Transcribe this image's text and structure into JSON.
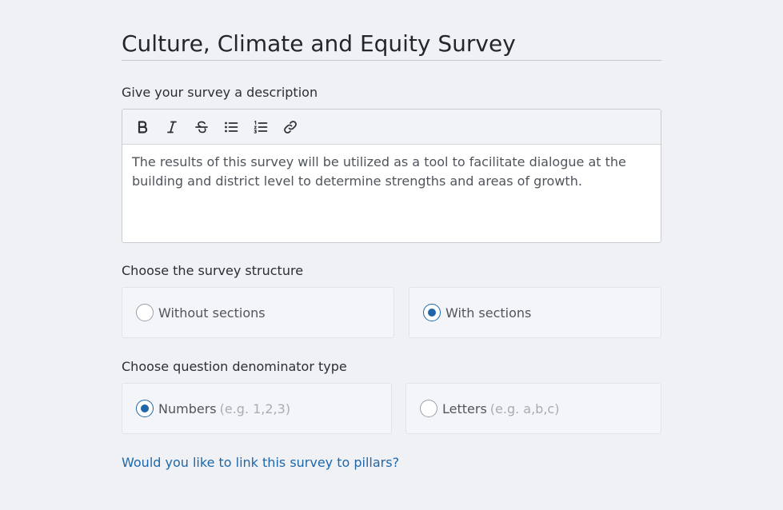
{
  "survey": {
    "title": "Culture, Climate and Equity Survey"
  },
  "description": {
    "label": "Give your survey a description",
    "text": "The results of this survey will be utilized as a tool to facilitate dialogue at the building and district level to determine strengths and areas of growth.",
    "toolbar": [
      {
        "name": "bold-icon"
      },
      {
        "name": "italic-icon"
      },
      {
        "name": "strikethrough-icon"
      },
      {
        "name": "bulleted-list-icon"
      },
      {
        "name": "numbered-list-icon"
      },
      {
        "name": "link-icon"
      }
    ]
  },
  "structure": {
    "label": "Choose the survey structure",
    "options": [
      {
        "label": "Without sections",
        "selected": false
      },
      {
        "label": "With sections",
        "selected": true
      }
    ]
  },
  "denominator": {
    "label": "Choose question denominator type",
    "options": [
      {
        "label": "Numbers",
        "hint": "(e.g. 1,2,3)",
        "selected": true
      },
      {
        "label": "Letters",
        "hint": "(e.g. a,b,c)",
        "selected": false
      }
    ]
  },
  "pillars_link": "Would you like to link this survey to pillars?",
  "colors": {
    "accent": "#1f67a8",
    "background": "#eff1f5",
    "option_bg": "#f4f5f9"
  }
}
